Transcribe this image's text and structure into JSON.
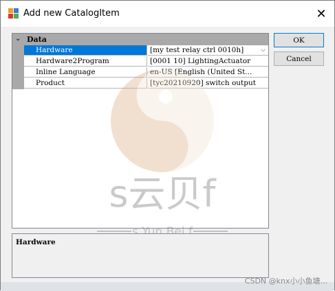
{
  "window": {
    "title": "Add new CatalogItem",
    "close_glyph": "✕"
  },
  "grid": {
    "category": "Data",
    "rows": [
      {
        "name": "Hardware",
        "value": "[my test relay ctrl 0010h]",
        "selected": true
      },
      {
        "name": "Hardware2Program",
        "value": "[0001 10] LightingActuator"
      },
      {
        "name": "Inline Language",
        "value": "en-US [English (United St..."
      },
      {
        "name": "Product",
        "value": "[tyc20210920] switch output"
      }
    ]
  },
  "description": {
    "title": "Hardware"
  },
  "buttons": {
    "ok": "OK",
    "cancel": "Cancel"
  },
  "watermark": {
    "brand": "s云贝f",
    "subtitle": "s Yun Bei f"
  },
  "credit": "CSDN @knx小小鱼塘...",
  "colors": {
    "selection": "#0078d7",
    "category_bg": "#a9a9a9",
    "logo": "#c87a3c"
  }
}
